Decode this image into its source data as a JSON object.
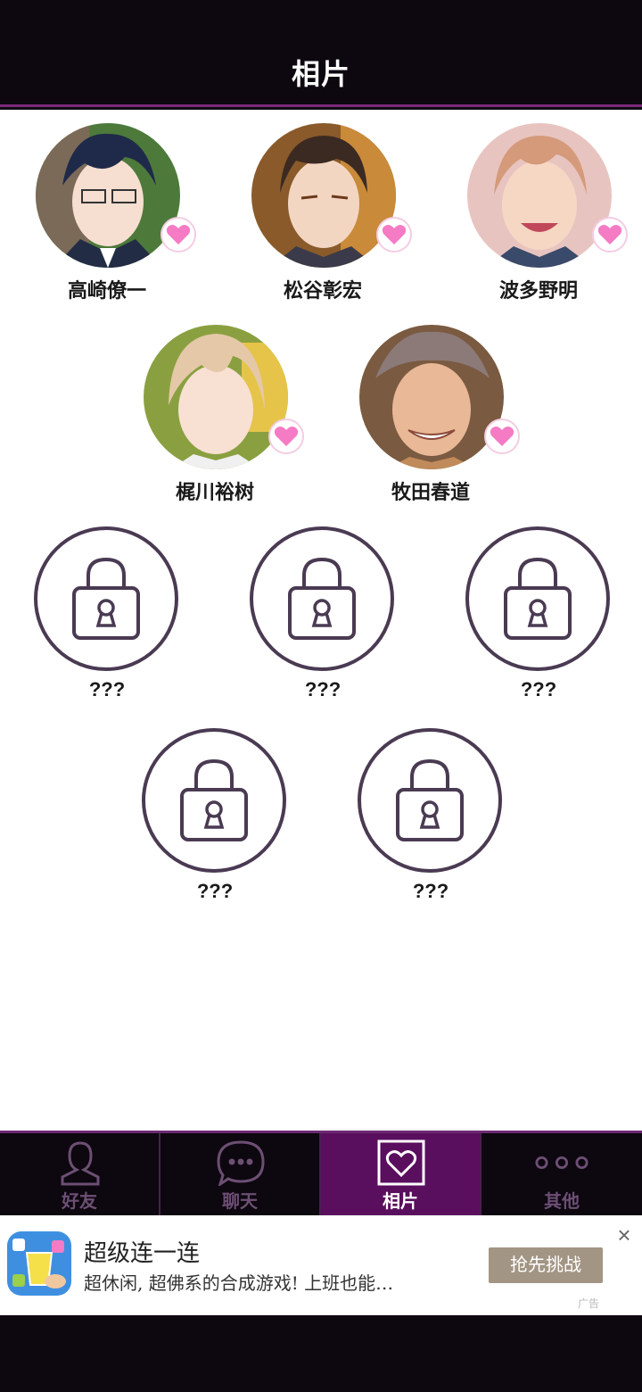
{
  "header": {
    "title": "相片"
  },
  "characters": [
    {
      "name": "高崎僚一",
      "unlocked": true,
      "icon": "heart-icon"
    },
    {
      "name": "松谷彰宏",
      "unlocked": true,
      "icon": "heart-icon"
    },
    {
      "name": "波多野明",
      "unlocked": true,
      "icon": "heart-icon"
    },
    {
      "name": "梶川裕树",
      "unlocked": true,
      "icon": "heart-icon"
    },
    {
      "name": "牧田春道",
      "unlocked": true,
      "icon": "heart-icon"
    },
    {
      "name": "???",
      "unlocked": false,
      "icon": "lock-icon"
    },
    {
      "name": "???",
      "unlocked": false,
      "icon": "lock-icon"
    },
    {
      "name": "???",
      "unlocked": false,
      "icon": "lock-icon"
    },
    {
      "name": "???",
      "unlocked": false,
      "icon": "lock-icon"
    },
    {
      "name": "???",
      "unlocked": false,
      "icon": "lock-icon"
    }
  ],
  "tabs": [
    {
      "label": "好友",
      "icon": "person-icon",
      "active": false
    },
    {
      "label": "聊天",
      "icon": "chat-bubble-icon",
      "active": false
    },
    {
      "label": "相片",
      "icon": "heart-frame-icon",
      "active": true
    },
    {
      "label": "其他",
      "icon": "more-dots-icon",
      "active": false
    }
  ],
  "ad": {
    "title": "超级连一连",
    "description": "超休闲, 超佛系的合成游戏! 上班也能…",
    "button": "抢先挑战",
    "close": "×",
    "mark": "广告"
  },
  "colors": {
    "background_dark": "#0d0710",
    "accent_purple": "#5a0f5e",
    "tab_inactive_text": "#6c4f73",
    "heart_pink": "#f47bc4",
    "lock_stroke": "#4a3a52"
  }
}
